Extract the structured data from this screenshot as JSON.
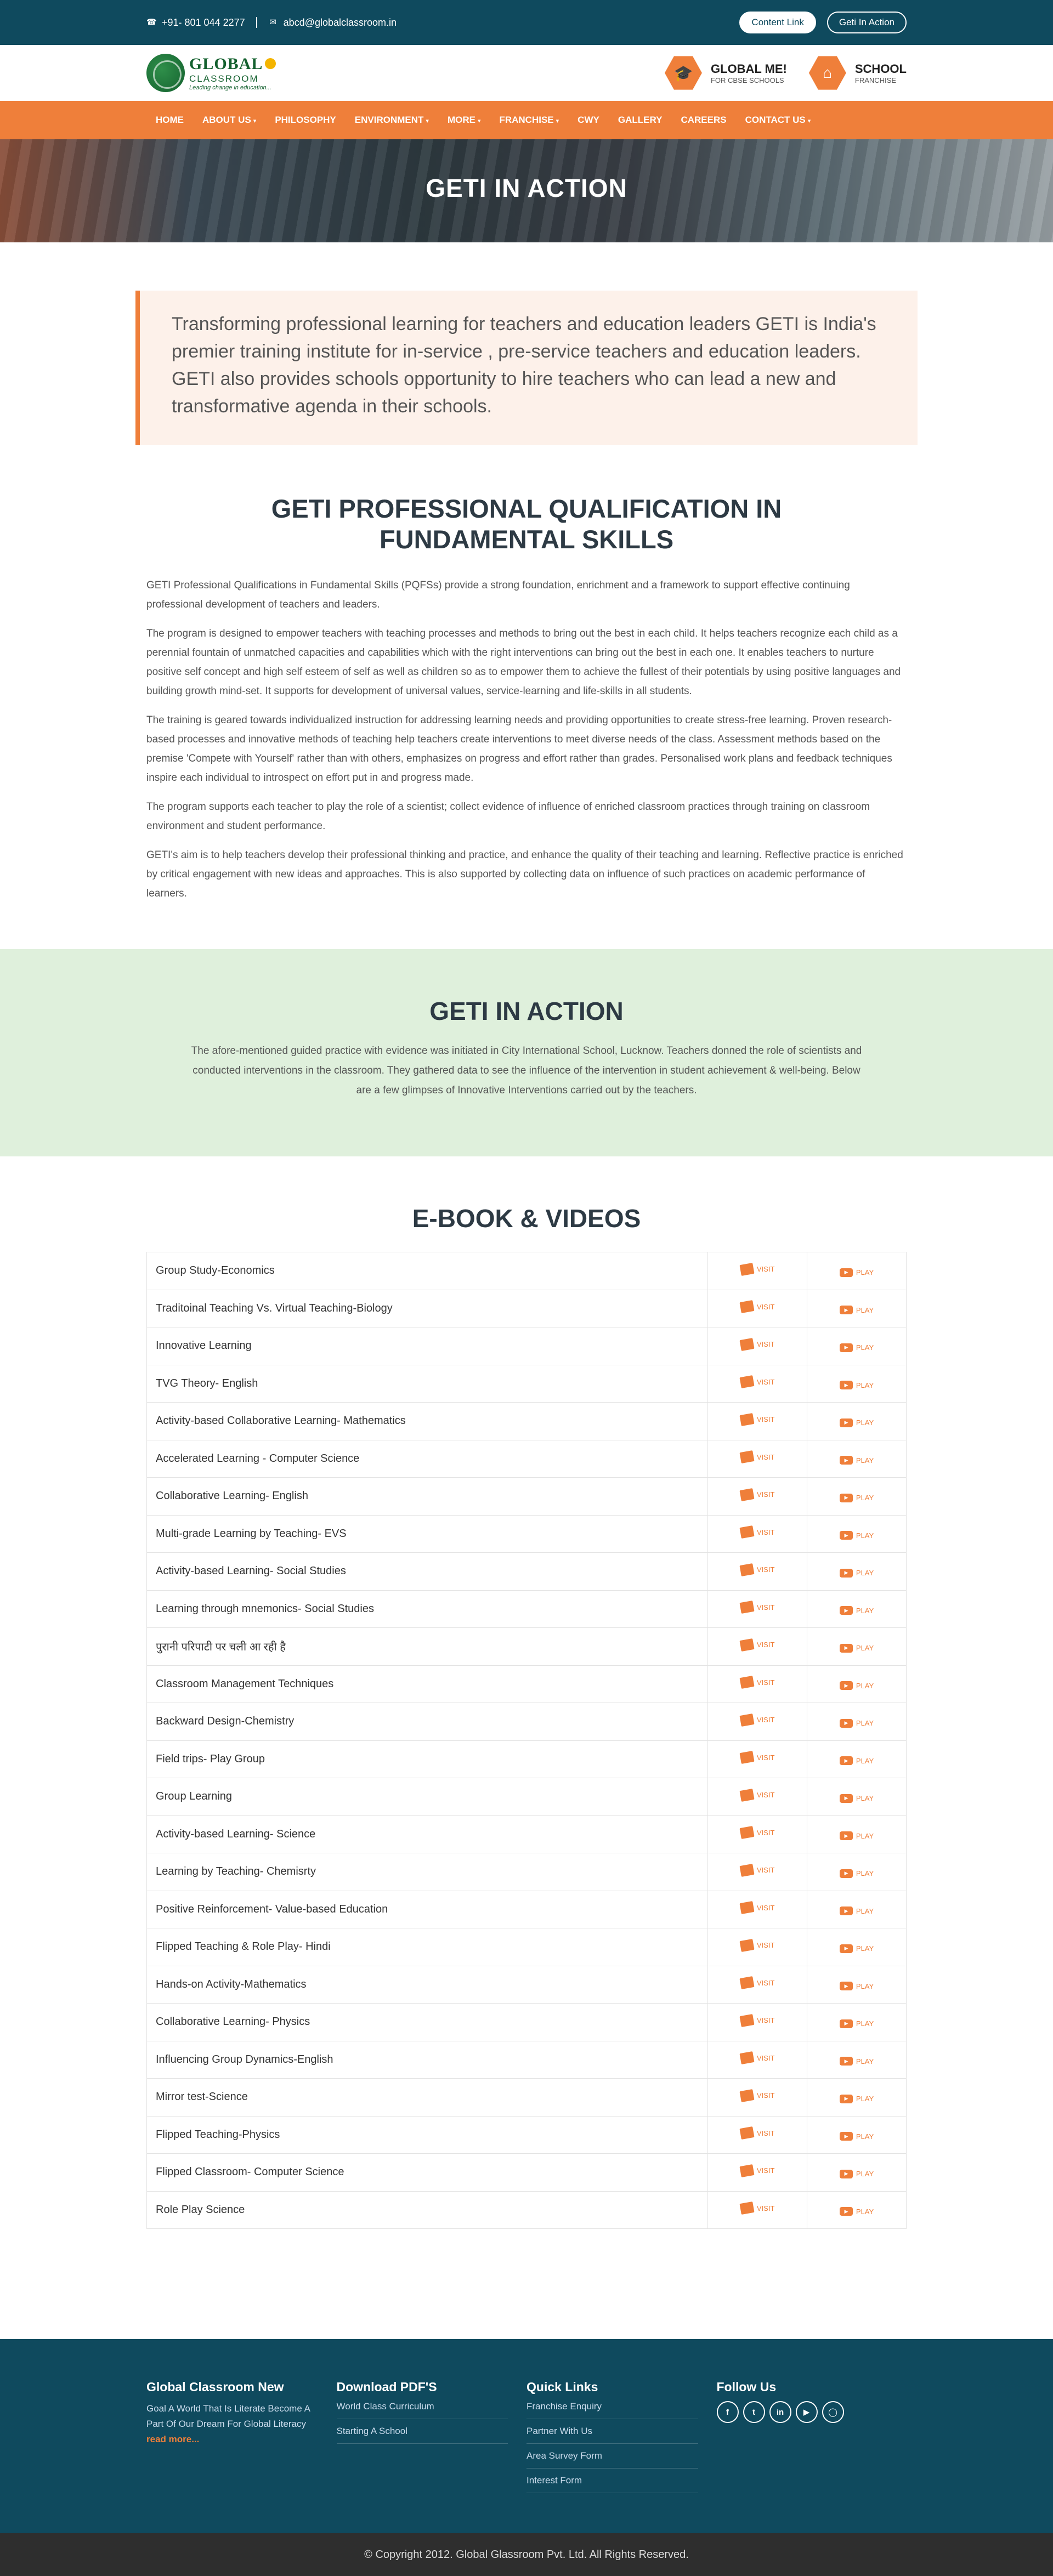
{
  "topbar": {
    "phone": "+91- 801 044 2277",
    "email": "abcd@globalclassroom.in",
    "content_link": "Content Link",
    "geti_in_action": "Geti In Action"
  },
  "logo": {
    "name_big": "GLOBAL",
    "name_mid": "CLASSROOM",
    "tagline": "Leading change in education..."
  },
  "badges": [
    {
      "title": "GLOBAL ME!",
      "subtitle": "FOR CBSE SCHOOLS"
    },
    {
      "title": "SCHOOL",
      "subtitle": "FRANCHISE"
    }
  ],
  "nav": [
    {
      "label": "HOME",
      "caret": false
    },
    {
      "label": "ABOUT US",
      "caret": true
    },
    {
      "label": "PHILOSOPHY",
      "caret": false
    },
    {
      "label": "ENVIRONMENT",
      "caret": true
    },
    {
      "label": "MORE",
      "caret": true
    },
    {
      "label": "FRANCHISE",
      "caret": true
    },
    {
      "label": "CWY",
      "caret": false
    },
    {
      "label": "GALLERY",
      "caret": false
    },
    {
      "label": "CAREERS",
      "caret": false
    },
    {
      "label": "CONTACT US",
      "caret": true
    }
  ],
  "hero": {
    "title": "GETI IN ACTION"
  },
  "intro": "Transforming professional learning for teachers and education leaders GETI is India's premier training institute for in-service , pre-service teachers and education leaders. GETI also provides schools opportunity to hire teachers who can lead a new and transformative agenda in their schools.",
  "pqf": {
    "title": "GETI PROFESSIONAL QUALIFICATION IN FUNDAMENTAL SKILLS",
    "paragraphs": [
      "GETI Professional Qualifications in Fundamental Skills (PQFSs) provide a strong foundation, enrichment and a framework to support effective continuing professional development of teachers and leaders.",
      "The program is designed to empower teachers with teaching processes and methods to bring out the best in each child. It helps teachers recognize each child as a perennial fountain of unmatched capacities and capabilities which with the right interventions can bring out the best in each one. It enables teachers to nurture positive self concept and high self esteem of self as well as children so as to empower them to achieve the fullest of their potentials by using positive languages and building growth mind-set. It supports for development of universal values, service-learning and life-skills in all students.",
      "The training is geared towards individualized instruction for addressing learning needs and providing opportunities to create stress-free learning. Proven research-based processes and innovative methods of teaching help teachers create interventions to meet diverse needs of the class. Assessment methods based on the premise 'Compete with Yourself' rather than with others, emphasizes on progress and effort rather than grades. Personalised work plans and feedback techniques inspire each individual to introspect on effort put in and progress made.",
      "The program supports each teacher to play the role of a scientist; collect evidence of influence of enriched classroom practices through training on classroom environment and student performance.",
      "GETI's aim is to help teachers develop their professional thinking and practice, and enhance the quality of their teaching and learning. Reflective practice is enriched by critical engagement with new ideas and approaches. This is also supported by collecting data on influence of such practices on academic performance of learners."
    ]
  },
  "action": {
    "title": "GETI IN ACTION",
    "text": "The afore-mentioned guided practice with evidence was initiated in City International School, Lucknow. Teachers donned the role of scientists and conducted interventions in the classroom. They gathered data to see the influence of the intervention in student achievement & well-being. Below are a few glimpses of Innovative Interventions carried out by the teachers."
  },
  "ebook": {
    "title": "E-BOOK & VIDEOS",
    "visit_label": "VISIT",
    "play_label": "PLAY",
    "rows": [
      "Group Study-Economics",
      "Traditoinal Teaching Vs. Virtual Teaching-Biology",
      "Innovative Learning",
      "TVG Theory- English",
      "Activity-based Collaborative Learning- Mathematics",
      "Accelerated Learning - Computer Science",
      "Collaborative Learning- English",
      "Multi-grade Learning by Teaching- EVS",
      "Activity-based Learning- Social Studies",
      "Learning through mnemonics- Social Studies",
      "पुरानी परिपाटी पर चली आ रही है",
      "Classroom Management Techniques",
      "Backward Design-Chemistry",
      "Field trips- Play Group",
      "Group Learning",
      "Activity-based Learning- Science",
      "Learning by Teaching- Chemisrty",
      "Positive Reinforcement- Value-based Education",
      "Flipped Teaching & Role Play- Hindi",
      "Hands-on Activity-Mathematics",
      "Collaborative Learning- Physics",
      "Influencing Group Dynamics-English",
      "Mirror test-Science",
      "Flipped Teaching-Physics",
      "Flipped Classroom- Computer Science",
      "Role Play Science"
    ]
  },
  "footer": {
    "col1": {
      "title": "Global Classroom New",
      "text": "Goal A World That Is Literate Become A Part Of Our Dream For Global Literacy",
      "more": "read more..."
    },
    "col2": {
      "title": "Download PDF'S",
      "links": [
        "World Class Curriculum",
        "Starting A School"
      ]
    },
    "col3": {
      "title": "Quick Links",
      "links": [
        "Franchise Enquiry",
        "Partner With Us",
        "Area Survey Form",
        "Interest Form"
      ]
    },
    "col4": {
      "title": "Follow Us",
      "socials": [
        "facebook-icon",
        "twitter-icon",
        "linkedin-icon",
        "youtube-icon",
        "instagram-icon"
      ]
    }
  },
  "copyright": "© Copyright 2012. Global Glassroom Pvt. Ltd. All Rights Reserved.",
  "colors": {
    "primary": "#0f4a5e",
    "accent": "#ef7f3a",
    "action_bg": "#dff0dc"
  }
}
